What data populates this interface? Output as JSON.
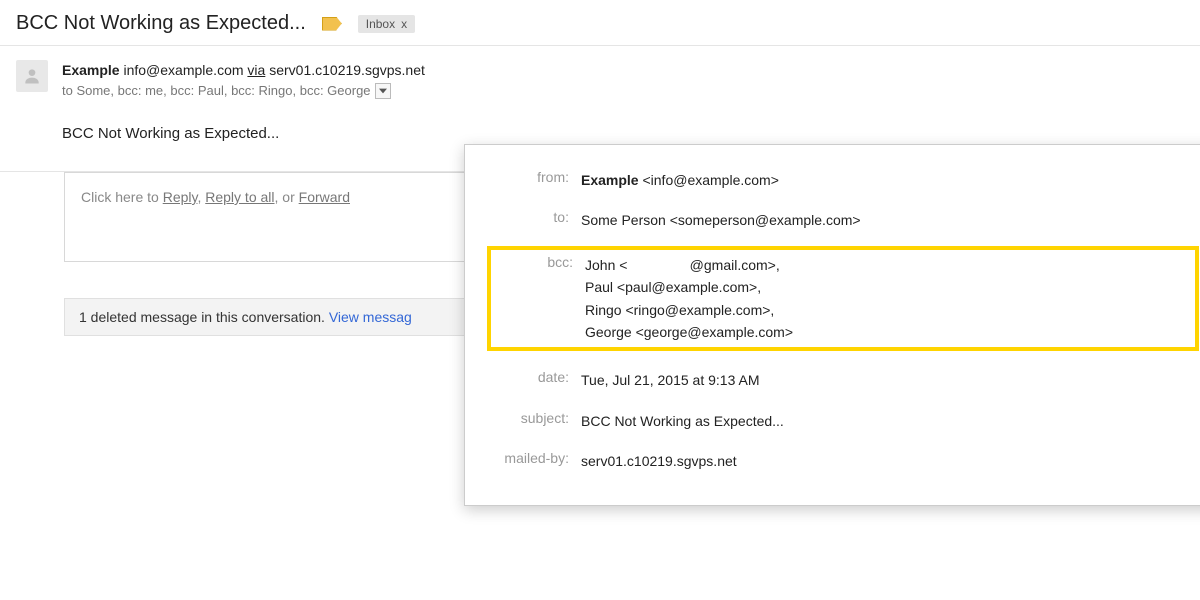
{
  "subject": "BCC Not Working as Expected...",
  "label_chip": {
    "text": "Inbox",
    "close": "x"
  },
  "sender": {
    "name": "Example",
    "address": "info@example.com",
    "via_word": "via",
    "via_server": "serv01.c10219.sgvps.net"
  },
  "recipients_summary": "to Some, bcc: me, bcc: Paul, bcc: Ringo, bcc: George",
  "body_preview": "BCC Not Working as Expected...",
  "reply_box": {
    "prefix": "Click here to ",
    "reply": "Reply",
    "sep1": ", ",
    "reply_all": "Reply to all",
    "sep2": ", or ",
    "forward": "Forward"
  },
  "deleted_notice": {
    "text": "1 deleted message in this conversation. ",
    "link": "View messag"
  },
  "details": {
    "labels": {
      "from": "from:",
      "to": "to:",
      "bcc": "bcc:",
      "date": "date:",
      "subject": "subject:",
      "mailed_by": "mailed-by:"
    },
    "from": {
      "name": "Example",
      "addr": "<info@example.com>"
    },
    "to": "Some Person <someperson@example.com>",
    "bcc": [
      "John <                @gmail.com>,",
      "Paul <paul@example.com>,",
      "Ringo <ringo@example.com>,",
      "George <george@example.com>"
    ],
    "date": "Tue, Jul 21, 2015 at 9:13 AM",
    "subject": "BCC Not Working as Expected...",
    "mailed_by": "serv01.c10219.sgvps.net"
  }
}
